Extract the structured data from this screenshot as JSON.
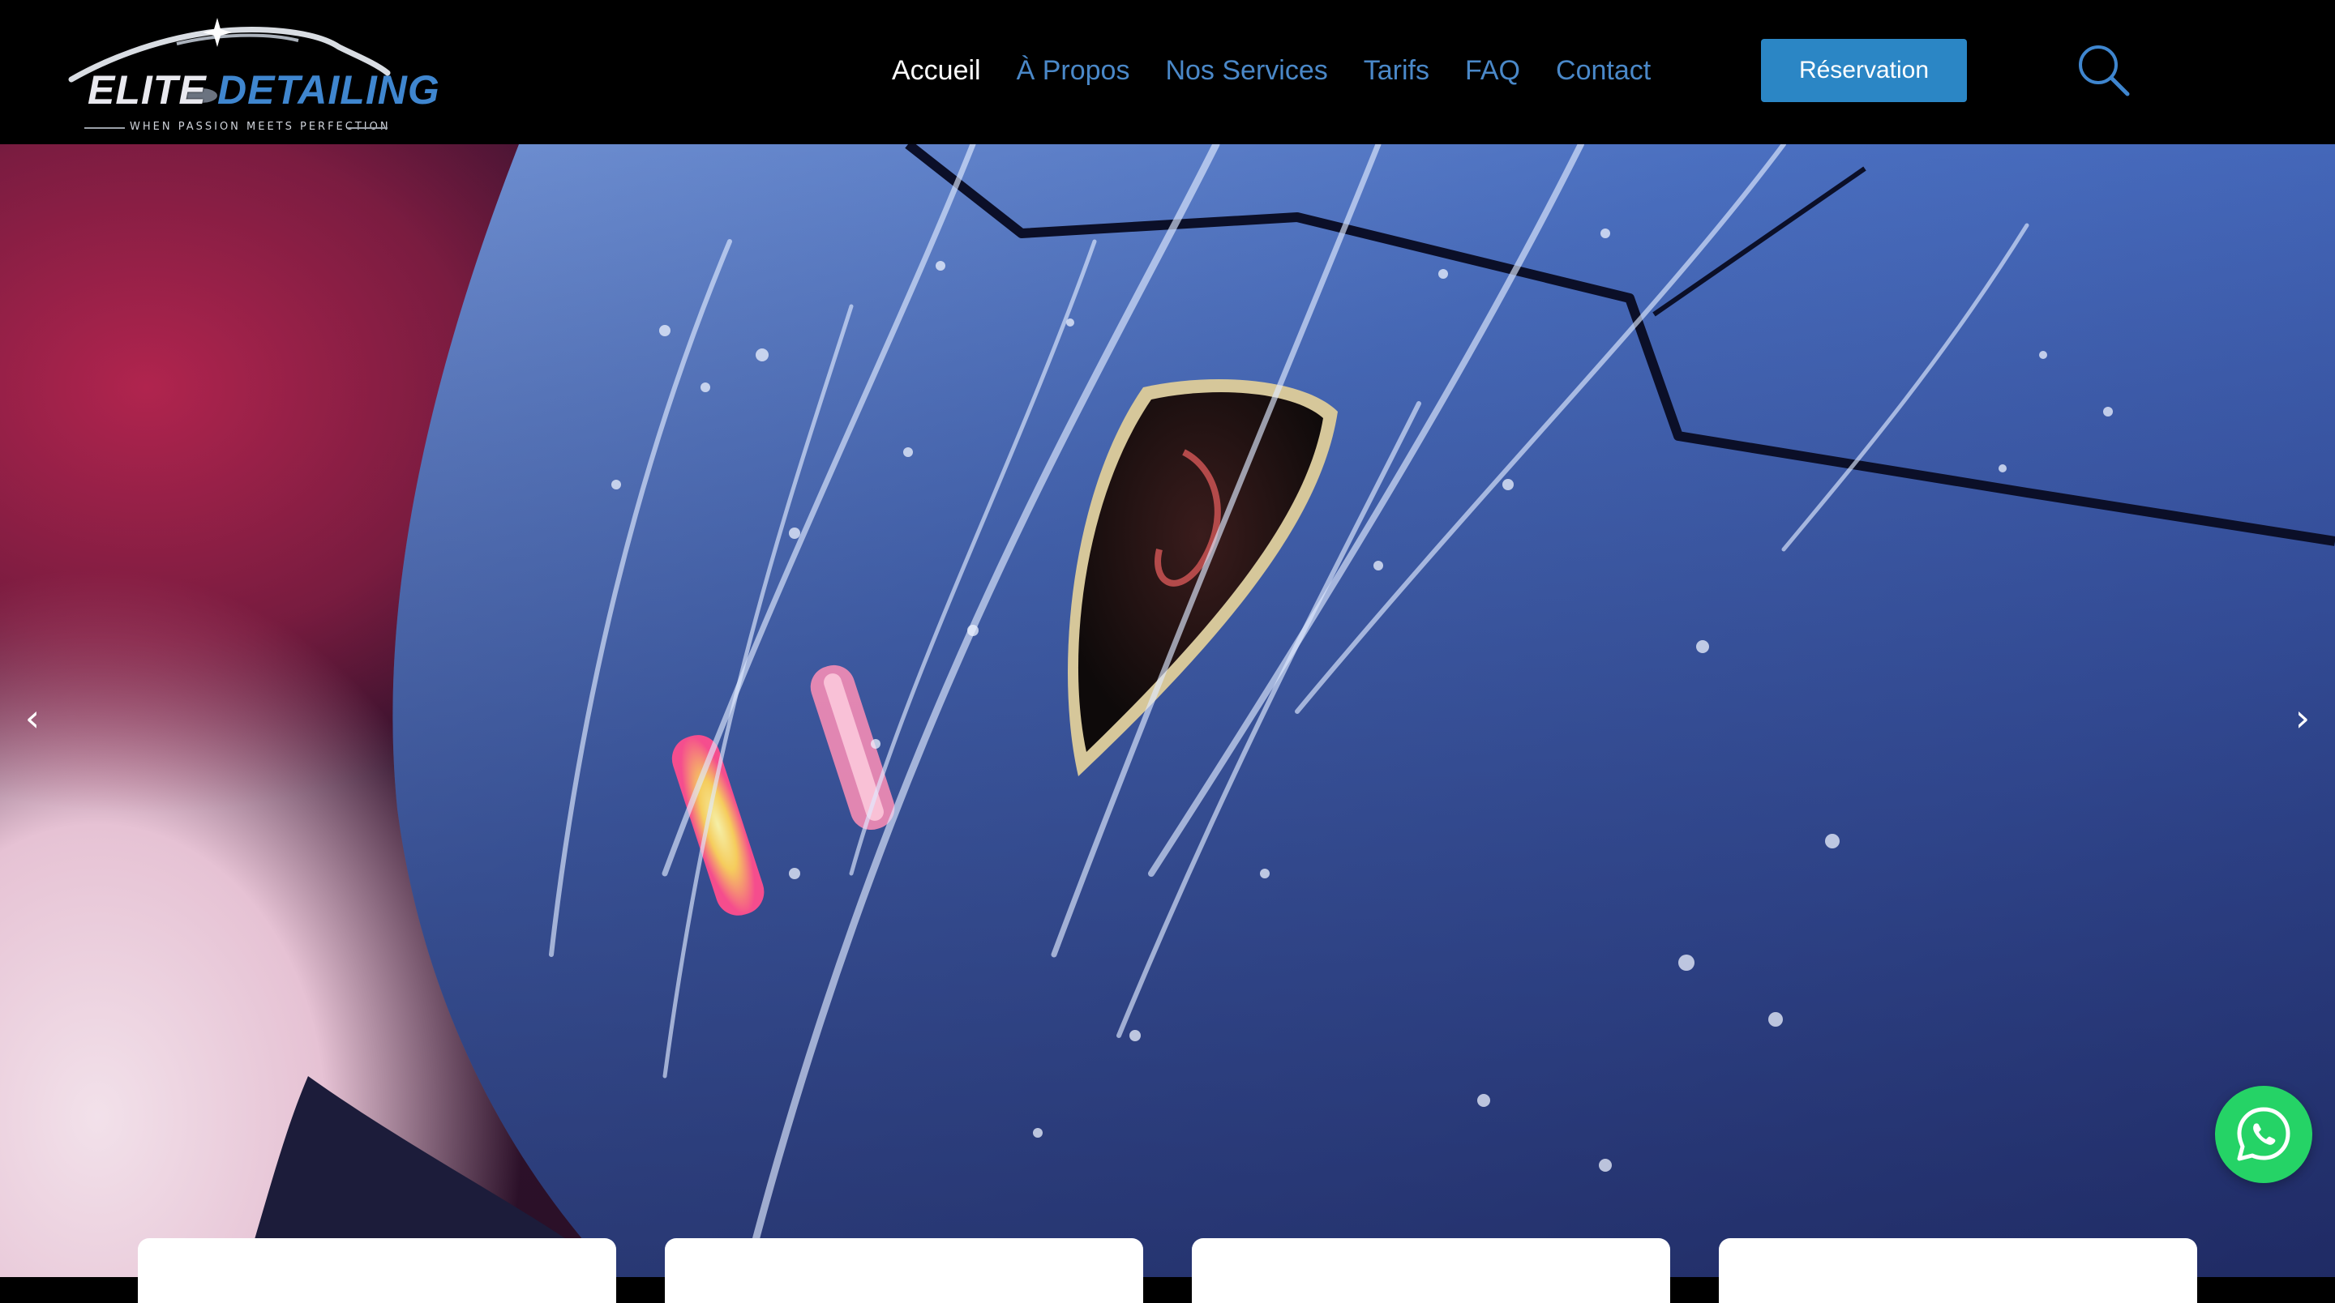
{
  "brand": {
    "name_part1": "ELITE",
    "name_part2": "DETAILING",
    "tagline": "WHEN PASSION MEETS PERFECTION"
  },
  "nav": {
    "items": [
      {
        "label": "Accueil",
        "active": true
      },
      {
        "label": "À Propos",
        "active": false
      },
      {
        "label": "Nos Services",
        "active": false
      },
      {
        "label": "Tarifs",
        "active": false
      },
      {
        "label": "FAQ",
        "active": false
      },
      {
        "label": "Contact",
        "active": false
      }
    ],
    "reserve_label": "Réservation",
    "search_icon": "search-icon"
  },
  "hero": {
    "prev_icon": "chevron-left-icon",
    "next_icon": "chevron-right-icon",
    "prev_glyph": "‹",
    "next_glyph": "›"
  },
  "floating": {
    "whatsapp_icon": "whatsapp-icon"
  },
  "colors": {
    "header_bg": "#000000",
    "accent_blue": "#2b86c5",
    "nav_link": "#4a88c8",
    "nav_active": "#ffffff",
    "whatsapp_green": "#25d366"
  }
}
